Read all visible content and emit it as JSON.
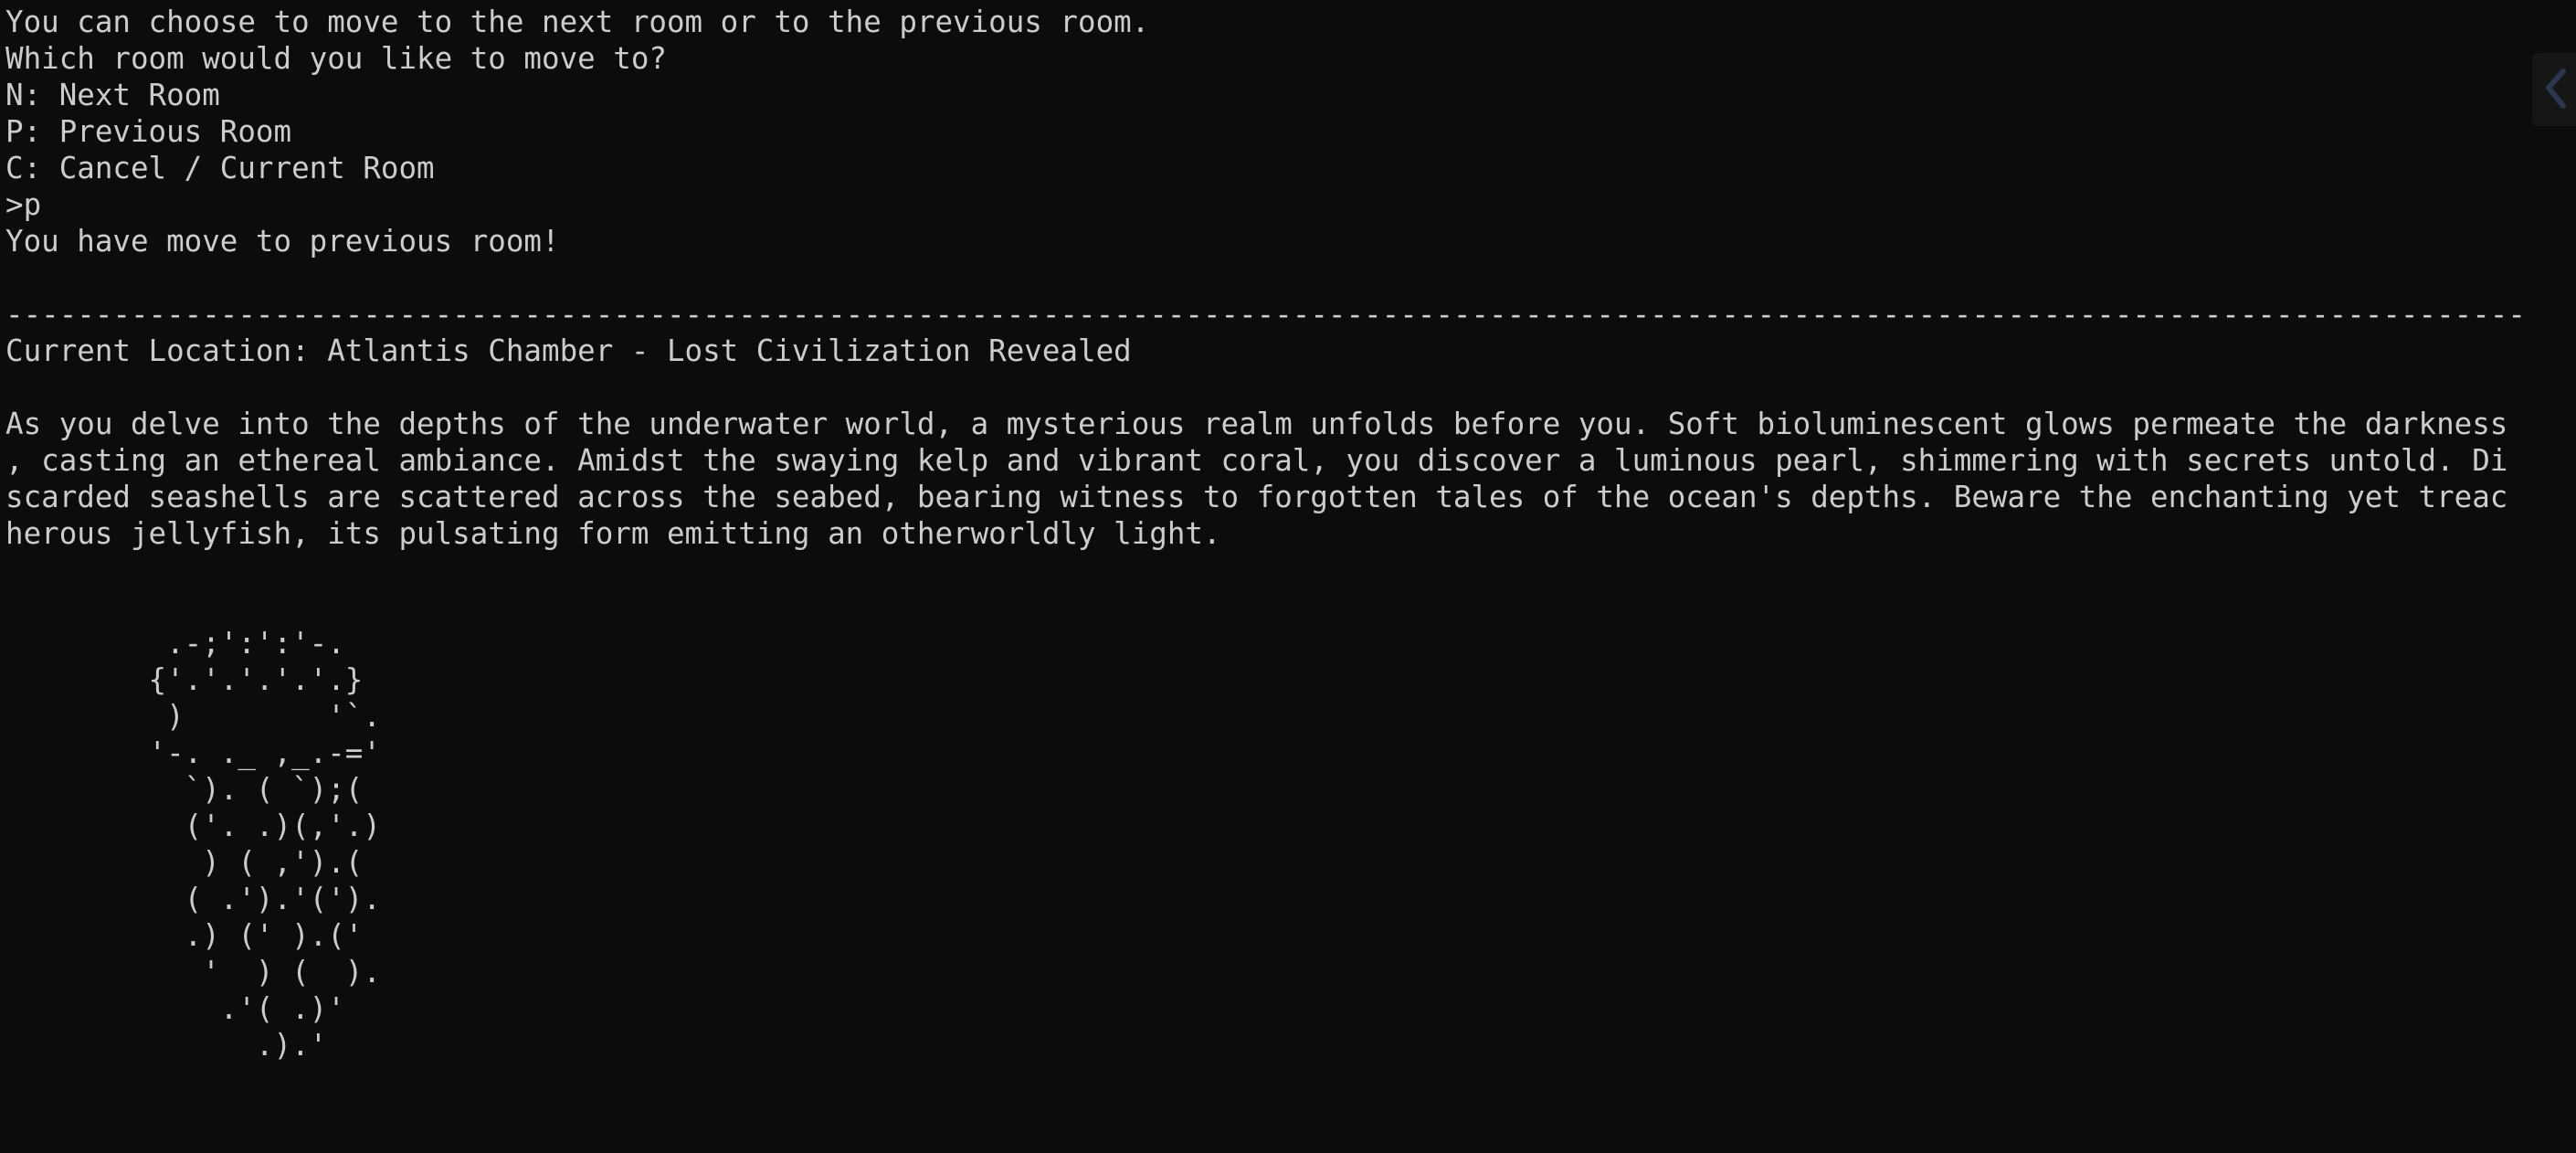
{
  "terminal": {
    "prompt_lines": [
      "You can choose to move to the next room or to the previous room.",
      "Which room would you like to move to?",
      "N: Next Room",
      "P: Previous Room",
      "C: Cancel / Current Room",
      ">p",
      "You have move to previous room!"
    ],
    "separator": "---------------------------------------------------------------------------------------------------------------------------------------------",
    "location_line": "Current Location: Atlantis Chamber - Lost Civilization Revealed",
    "description_lines": [
      "As you delve into the depths of the underwater world, a mysterious realm unfolds before you. Soft bioluminescent glows permeate the darkness",
      ", casting an ethereal ambiance. Amidst the swaying kelp and vibrant coral, you discover a luminous pearl, shimmering with secrets untold. Di",
      "scarded seashells are scattered across the seabed, bearing witness to forgotten tales of the ocean's depths. Beware the enchanting yet treac",
      "herous jellyfish, its pulsating form emitting an otherworldly light."
    ],
    "ascii_art": [
      "         .-;':':'-.",
      "        {'.'.'.'.'.}",
      "         )        '`.",
      "        '-. ._ ,_.-='",
      "          `). ( `);(",
      "          ('. .)(,'.)",
      "           ) ( ,').(",
      "          ( .').'(').",
      "          .) (' ).('",
      "           '  ) (  ).",
      "            .'( .)'",
      "              .).'"
    ]
  },
  "colors": {
    "background": "#0c0c0c",
    "foreground": "#cccccc"
  },
  "icons": {
    "scroll_marker": "scrollbar-marker-icon"
  }
}
